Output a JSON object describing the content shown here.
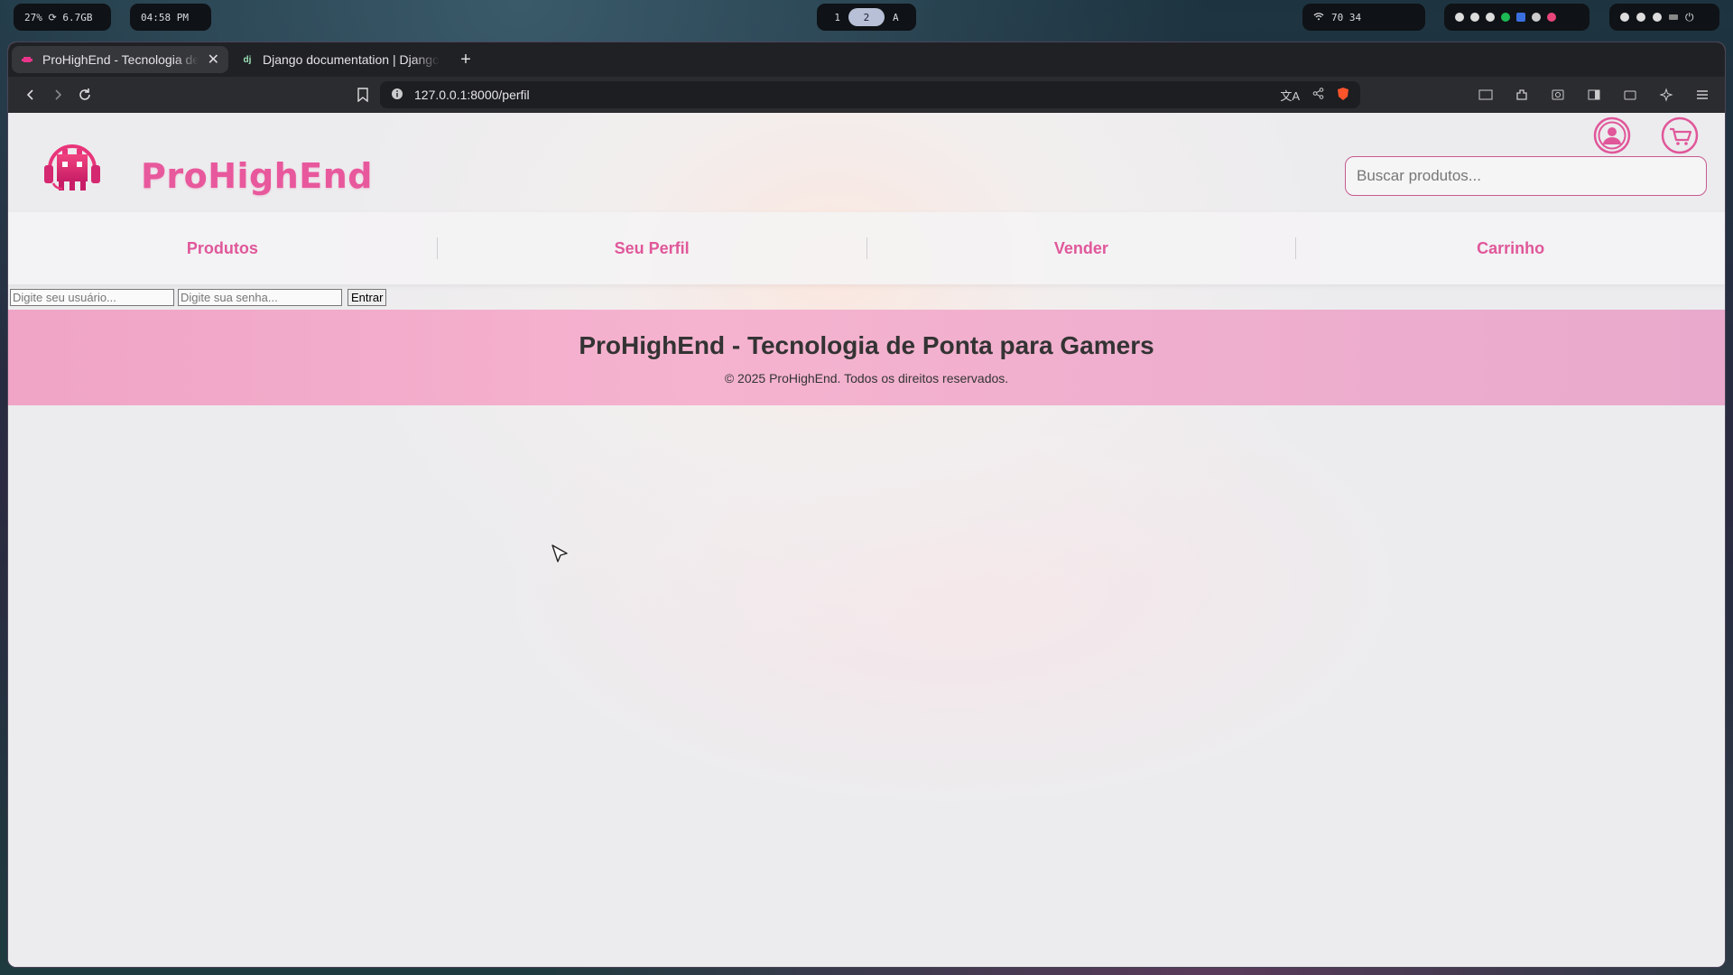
{
  "system_bar": {
    "stats": "27% ⟳ 6.7GB",
    "clock": "04:58 PM",
    "workspaces": [
      "1",
      "2",
      "A"
    ],
    "status_right": "70  34"
  },
  "browser": {
    "tabs": [
      {
        "title": "ProHighEnd - Tecnologia de Ponta para Gamers",
        "active": true,
        "favicon": "invader"
      },
      {
        "title": "Django documentation | Django documentation",
        "active": false,
        "favicon": "dj"
      }
    ],
    "url": "127.0.0.1:8000/perfil"
  },
  "site": {
    "brand": "ProHighEnd",
    "search_placeholder": "Buscar produtos...",
    "nav": [
      "Produtos",
      "Seu Perfil",
      "Vender",
      "Carrinho"
    ],
    "login": {
      "user_placeholder": "Digite seu usuário...",
      "pass_placeholder": "Digite sua senha...",
      "submit": "Entrar"
    },
    "footer": {
      "title": "ProHighEnd - Tecnologia de Ponta para Gamers",
      "copyright": "© 2025 ProHighEnd. Todos os direitos reservados."
    },
    "accent": "#e0579a"
  }
}
